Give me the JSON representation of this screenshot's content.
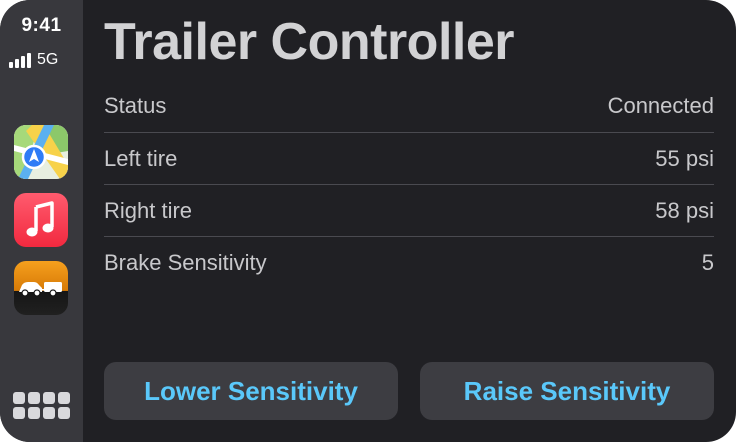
{
  "status_bar": {
    "time": "9:41",
    "network": "5G"
  },
  "sidebar": {
    "apps": [
      {
        "name": "Maps",
        "icon": "maps-icon"
      },
      {
        "name": "Music",
        "icon": "music-icon"
      },
      {
        "name": "Trailer Controller",
        "icon": "trailer-icon"
      }
    ],
    "app_grid_icon": "app-grid-icon"
  },
  "main": {
    "title": "Trailer Controller",
    "rows": [
      {
        "label": "Status",
        "value": "Connected"
      },
      {
        "label": "Left tire",
        "value": "55 psi"
      },
      {
        "label": "Right tire",
        "value": "58 psi"
      },
      {
        "label": "Brake Sensitivity",
        "value": "5"
      }
    ],
    "buttons": {
      "lower": "Lower Sensitivity",
      "raise": "Raise Sensitivity"
    }
  },
  "colors": {
    "background": "#202024",
    "sidebar": "#38383d",
    "accent": "#5ac8fa",
    "button_bg": "#3d3d42"
  }
}
